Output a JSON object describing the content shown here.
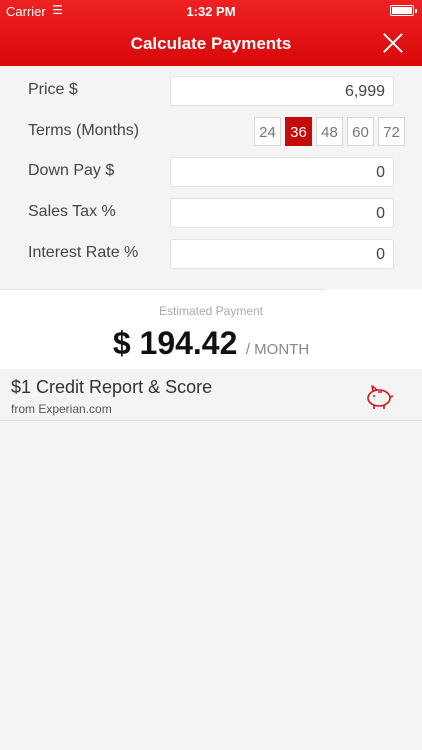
{
  "status_bar": {
    "carrier": "Carrier",
    "time": "1:32 PM",
    "wifi_icon": "wifi-icon",
    "battery_icon": "battery-icon"
  },
  "header": {
    "title": "Calculate Payments",
    "close_icon": "close-icon",
    "accent": "#e8191b"
  },
  "form": {
    "price": {
      "label": "Price $",
      "value": "6,999"
    },
    "terms": {
      "label": "Terms (Months)",
      "options": [
        "24",
        "36",
        "48",
        "60",
        "72"
      ],
      "selected": "36"
    },
    "down_pay": {
      "label": "Down Pay $",
      "value": "0"
    },
    "sales_tax": {
      "label": "Sales Tax %",
      "value": "0"
    },
    "interest_rate": {
      "label": "Interest Rate %",
      "value": "0"
    }
  },
  "estimate": {
    "label": "Estimated Payment",
    "amount": "$ 194.42",
    "per": "/ MONTH"
  },
  "offer": {
    "title": "$1 Credit Report & Score",
    "subtitle": "from Experian.com",
    "icon": "piggy-bank-icon",
    "icon_color": "#d0161c"
  }
}
